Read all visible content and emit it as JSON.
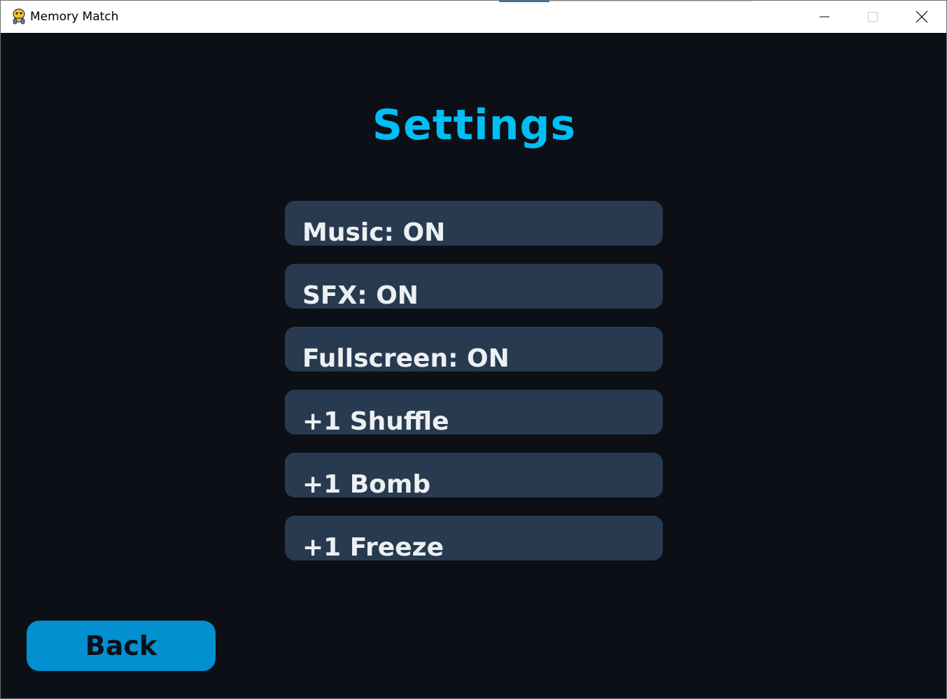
{
  "window": {
    "title": "Memory Match",
    "app_icon": "python-icon",
    "controls": {
      "minimize_icon": "minimize-icon",
      "maximize_icon": "maximize-icon",
      "close_icon": "close-icon"
    }
  },
  "screen": {
    "heading": "Settings",
    "options": [
      {
        "label": "Music: ON"
      },
      {
        "label": "SFX: ON"
      },
      {
        "label": "Fullscreen: ON"
      },
      {
        "label": "+1 Shuffle"
      },
      {
        "label": "+1 Bomb"
      },
      {
        "label": "+1 Freeze"
      }
    ],
    "back_label": "Back"
  },
  "colors": {
    "background": "#0c0f16",
    "heading": "#00bff5",
    "option_button": "#283a4f",
    "option_text": "#ecf0f3",
    "back_button": "#0290d0",
    "back_text": "#0a1018"
  }
}
